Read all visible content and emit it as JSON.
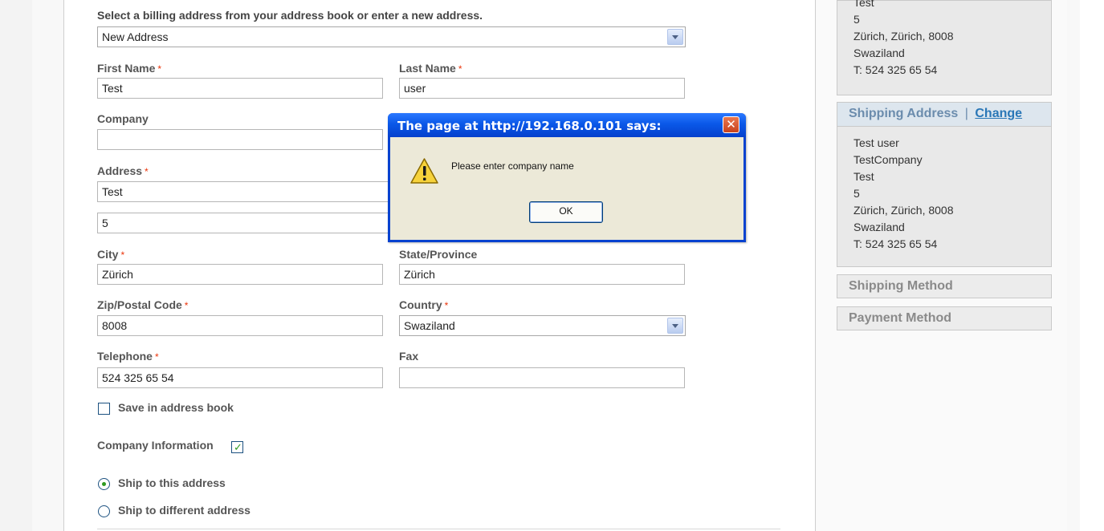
{
  "billing": {
    "intro": "Select a billing address from your address book or enter a new address.",
    "address_select": "New Address",
    "required_marker": "*",
    "first_name": {
      "label": "First Name",
      "value": "Test"
    },
    "last_name": {
      "label": "Last Name",
      "value": "user"
    },
    "company": {
      "label": "Company",
      "value": ""
    },
    "address": {
      "label": "Address",
      "line1": "Test",
      "line2": "5"
    },
    "city": {
      "label": "City",
      "value": "Zürich"
    },
    "state": {
      "label": "State/Province",
      "value": "Zürich"
    },
    "zip": {
      "label": "Zip/Postal Code",
      "value": "8008"
    },
    "country": {
      "label": "Country",
      "value": "Swaziland"
    },
    "telephone": {
      "label": "Telephone",
      "value": "524 325 65 54"
    },
    "fax": {
      "label": "Fax",
      "value": ""
    },
    "save_in_address_book": {
      "label": "Save in address book",
      "checked": false
    },
    "company_information": {
      "label": "Company Information",
      "checked": true
    },
    "ship_to_this": {
      "label": "Ship to this address",
      "selected": true
    },
    "ship_to_different": {
      "label": "Ship to different address",
      "selected": false
    }
  },
  "sidebar": {
    "billing_box": {
      "lines": [
        "Test",
        "5",
        "Zürich, Zürich, 8008",
        "Swaziland",
        "T: 524 325 65 54"
      ]
    },
    "shipping_address": {
      "title": "Shipping Address",
      "separator": "|",
      "change_link": "Change",
      "lines": [
        "Test user",
        "TestCompany",
        "Test",
        "5",
        "Zürich, Zürich, 8008",
        "Swaziland",
        "T: 524 325 65 54"
      ]
    },
    "shipping_method": {
      "title": "Shipping Method"
    },
    "payment_method": {
      "title": "Payment Method"
    }
  },
  "dialog": {
    "title": "The page at http://192.168.0.101 says:",
    "close_glyph": "✕",
    "message": "Please enter company name",
    "ok_label": "OK"
  },
  "colors": {
    "required": "#eb340a",
    "dialog_title": "#0a58e8",
    "link": "#2a77b7"
  }
}
